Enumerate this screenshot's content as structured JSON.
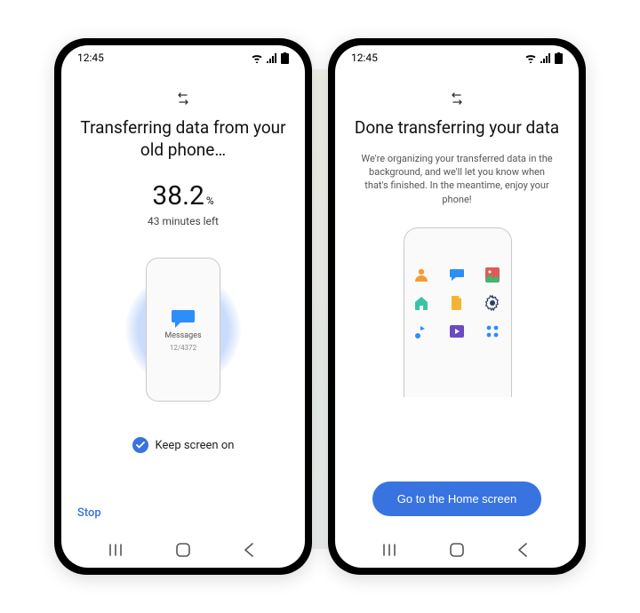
{
  "left": {
    "status_time": "12:45",
    "title": "Transferring data from your old phone…",
    "percent_value": "38.2",
    "percent_symbol": "%",
    "eta": "43 minutes left",
    "item_label": "Messages",
    "item_count": "12/4372",
    "keep_screen_on": "Keep screen on",
    "stop": "Stop"
  },
  "right": {
    "status_time": "12:45",
    "title": "Done transferring your data",
    "sub": "We're organizing your transferred data in the background, and we'll let you know when that's finished. In the meantime, enjoy your phone!",
    "cta": "Go to the Home screen"
  },
  "colors": {
    "accent": "#3873e0"
  }
}
